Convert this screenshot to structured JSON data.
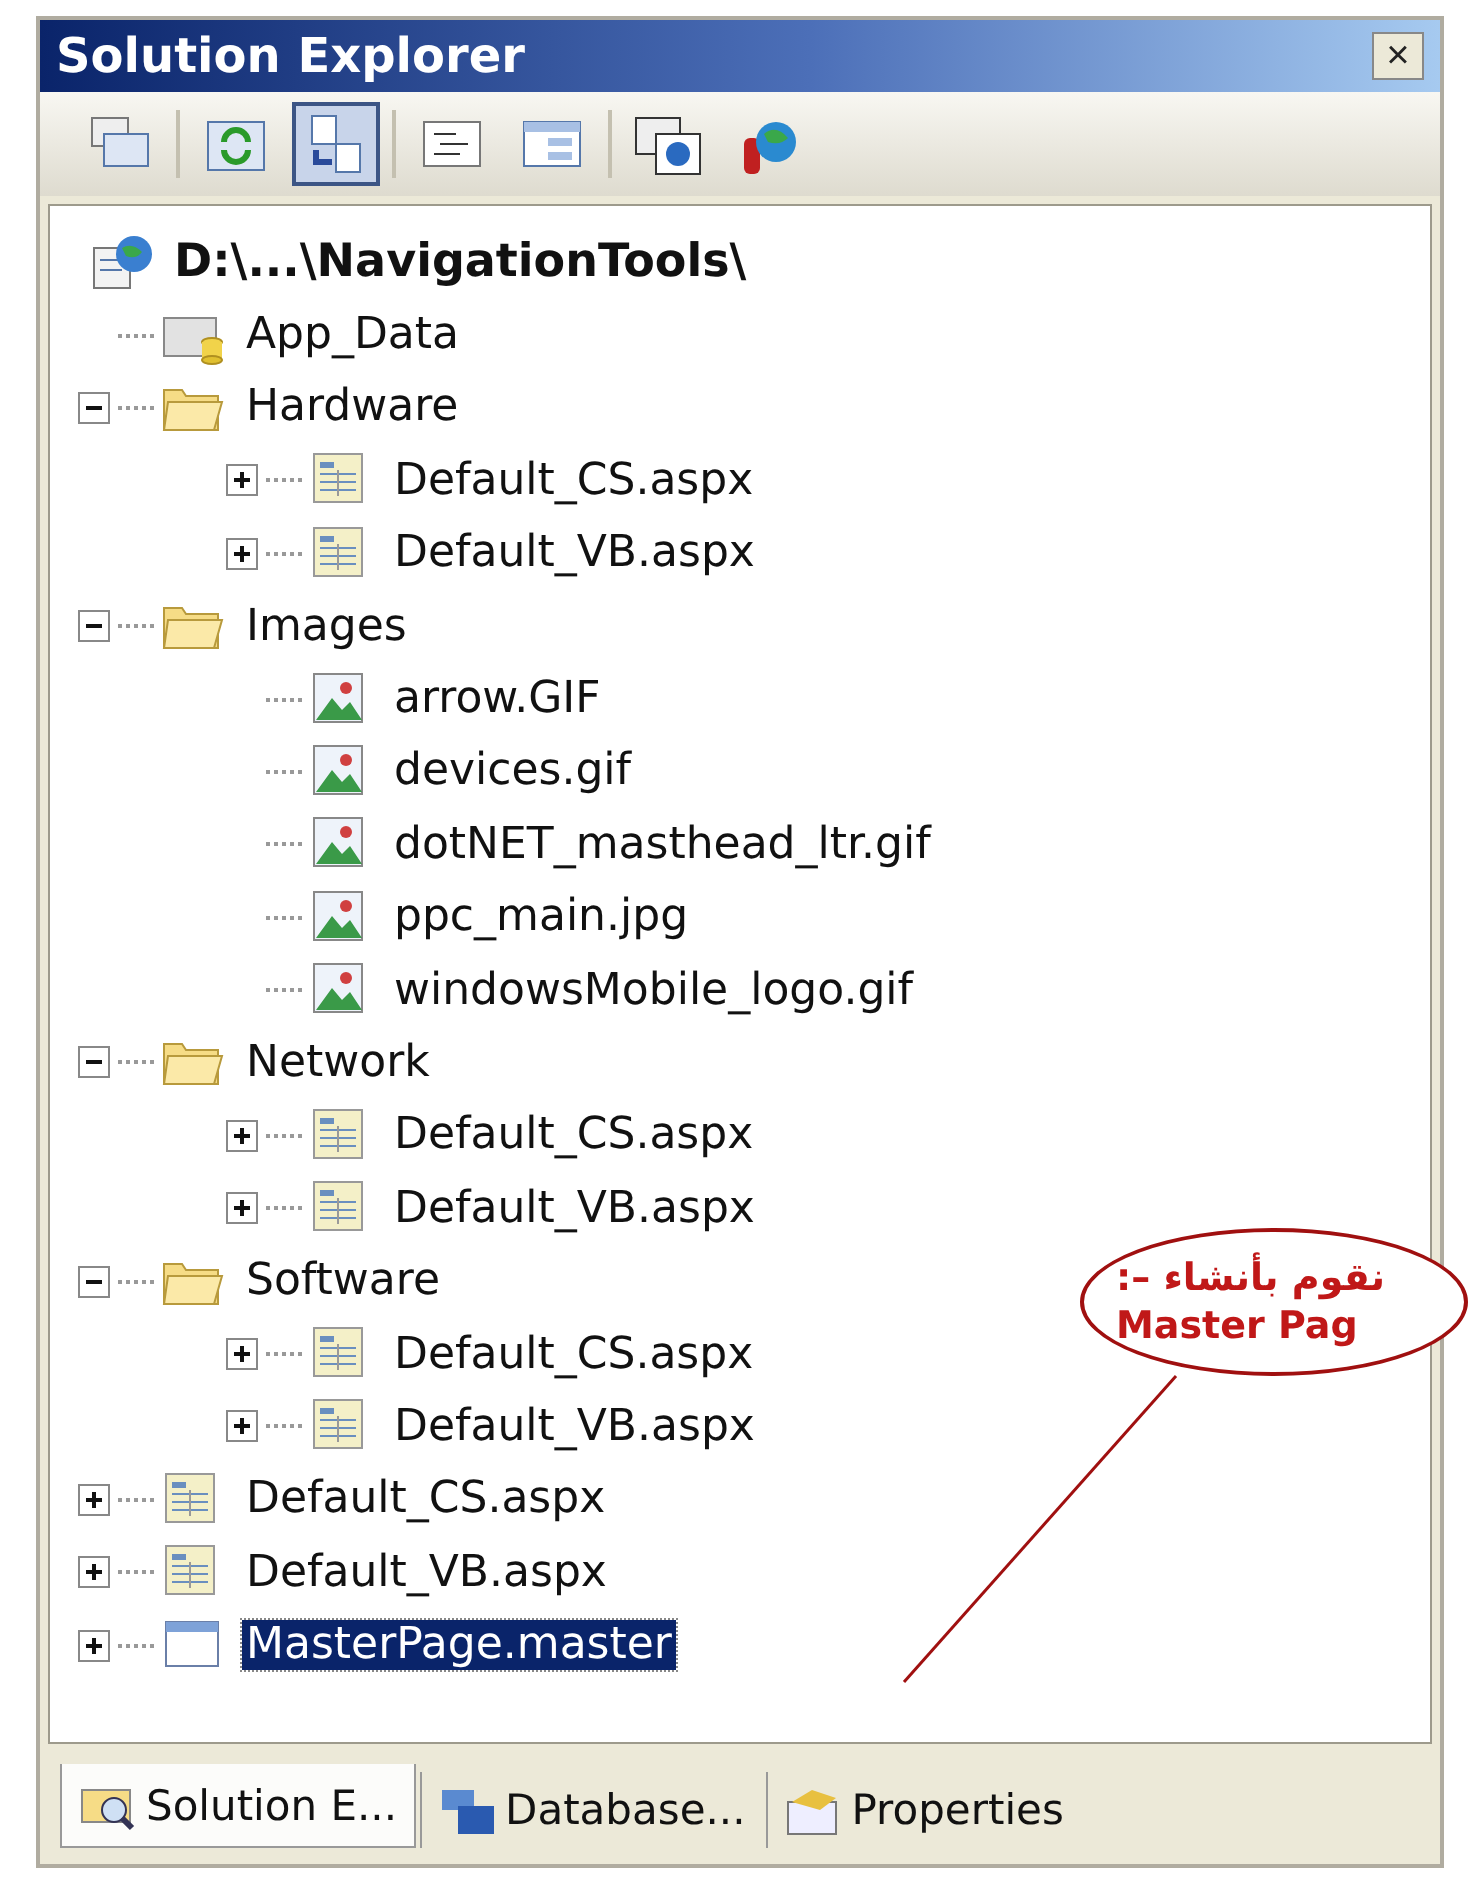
{
  "window": {
    "title": "Solution Explorer",
    "close": "×"
  },
  "toolbar": [
    {
      "kind": "properties",
      "pressed": false
    },
    {
      "kind": "refresh",
      "pressed": false
    },
    {
      "kind": "nest",
      "pressed": true
    },
    {
      "kind": "code",
      "pressed": false
    },
    {
      "kind": "designer",
      "pressed": false
    },
    {
      "kind": "web",
      "pressed": false
    },
    {
      "kind": "config",
      "pressed": false
    }
  ],
  "tree": {
    "label": "D:\\...\\NavigationTools\\",
    "kind": "project",
    "children": [
      {
        "label": "App_Data",
        "kind": "datafolder"
      },
      {
        "label": "Hardware",
        "kind": "folder",
        "expanded": true,
        "children": [
          {
            "label": "Default_CS.aspx",
            "kind": "page",
            "expanded": false
          },
          {
            "label": "Default_VB.aspx",
            "kind": "page",
            "expanded": false
          }
        ]
      },
      {
        "label": "Images",
        "kind": "folder",
        "expanded": true,
        "children": [
          {
            "label": "arrow.GIF",
            "kind": "image"
          },
          {
            "label": "devices.gif",
            "kind": "image"
          },
          {
            "label": "dotNET_masthead_ltr.gif",
            "kind": "image"
          },
          {
            "label": "ppc_main.jpg",
            "kind": "image"
          },
          {
            "label": "windowsMobile_logo.gif",
            "kind": "image"
          }
        ]
      },
      {
        "label": "Network",
        "kind": "folder",
        "expanded": true,
        "children": [
          {
            "label": "Default_CS.aspx",
            "kind": "page",
            "expanded": false
          },
          {
            "label": "Default_VB.aspx",
            "kind": "page",
            "expanded": false
          }
        ]
      },
      {
        "label": "Software",
        "kind": "folder",
        "expanded": true,
        "children": [
          {
            "label": "Default_CS.aspx",
            "kind": "page",
            "expanded": false
          },
          {
            "label": "Default_VB.aspx",
            "kind": "page",
            "expanded": false
          }
        ]
      },
      {
        "label": "Default_CS.aspx",
        "kind": "page",
        "expanded": false,
        "selected": false
      },
      {
        "label": "Default_VB.aspx",
        "kind": "page",
        "expanded": false,
        "selected": false
      },
      {
        "label": "MasterPage.master",
        "kind": "master",
        "expanded": false,
        "selected": true
      }
    ]
  },
  "tabs": [
    {
      "label": "Solution E...",
      "kind": "explorer",
      "selected": true
    },
    {
      "label": "Database...",
      "kind": "database",
      "selected": false
    },
    {
      "label": "Properties",
      "kind": "properties",
      "selected": false
    }
  ],
  "callout": {
    "lines": [
      "نقوم بأنشاء –:",
      "Master Pag"
    ]
  }
}
